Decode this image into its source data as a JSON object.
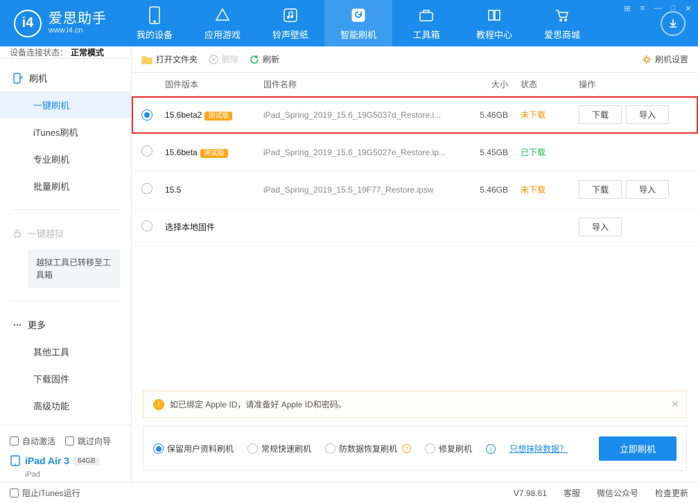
{
  "app": {
    "brand": "爱思助手",
    "url": "www.i4.cn"
  },
  "nav": {
    "items": [
      {
        "label": "我的设备"
      },
      {
        "label": "应用游戏"
      },
      {
        "label": "铃声壁纸"
      },
      {
        "label": "智能刷机"
      },
      {
        "label": "工具箱"
      },
      {
        "label": "教程中心"
      },
      {
        "label": "爱思商城"
      }
    ]
  },
  "status": {
    "label": "设备连接状态：",
    "value": "正常模式"
  },
  "sidebar": {
    "flash": {
      "head": "刷机",
      "items": [
        "一键刷机",
        "iTunes刷机",
        "专业刷机",
        "批量刷机"
      ]
    },
    "jailbreak": {
      "head": "一键越狱",
      "note": "越狱工具已转移至工具箱"
    },
    "more": {
      "head": "更多",
      "items": [
        "其他工具",
        "下载固件",
        "高级功能"
      ]
    }
  },
  "sidebar_bottom": {
    "auto_activate": "自动激活",
    "skip_guide": "跳过向导",
    "device_name": "iPad Air 3",
    "storage": "64GB",
    "device_type": "iPad"
  },
  "toolbar": {
    "open": "打开文件夹",
    "delete": "删除",
    "refresh": "刷新",
    "settings": "刷机设置"
  },
  "table": {
    "headers": {
      "version": "固件版本",
      "name": "固件名称",
      "size": "大小",
      "status": "状态",
      "action": "操作"
    },
    "rows": [
      {
        "version": "15.6beta2",
        "beta": "测试版",
        "name": "iPad_Spring_2019_15.6_19G5037d_Restore.i...",
        "size": "5.46GB",
        "status": "未下载",
        "status_class": "nd",
        "selected": true,
        "highlighted": true,
        "download": "下载",
        "import": "导入"
      },
      {
        "version": "15.6beta",
        "beta": "测试版",
        "name": "iPad_Spring_2019_15.6_19G5027e_Restore.ip...",
        "size": "5.45GB",
        "status": "已下载",
        "status_class": "dl",
        "selected": false
      },
      {
        "version": "15.5",
        "name": "iPad_Spring_2019_15.5_19F77_Restore.ipsw",
        "size": "5.46GB",
        "status": "未下载",
        "status_class": "nd",
        "selected": false,
        "download": "下载",
        "import": "导入"
      },
      {
        "version": "选择本地固件",
        "local": true,
        "import": "导入"
      }
    ]
  },
  "alert": {
    "text": "如已绑定 Apple ID，请准备好 Apple ID和密码。"
  },
  "options": {
    "items": [
      "保留用户资料刷机",
      "常规快速刷机",
      "防数据恢复刷机",
      "修复刷机"
    ],
    "link": "只想抹除数据？",
    "primary": "立即刷机"
  },
  "footer": {
    "block_itunes": "阻止iTunes运行",
    "version": "V7.98.61",
    "support": "客服",
    "wechat": "微信公众号",
    "update": "检查更新"
  }
}
